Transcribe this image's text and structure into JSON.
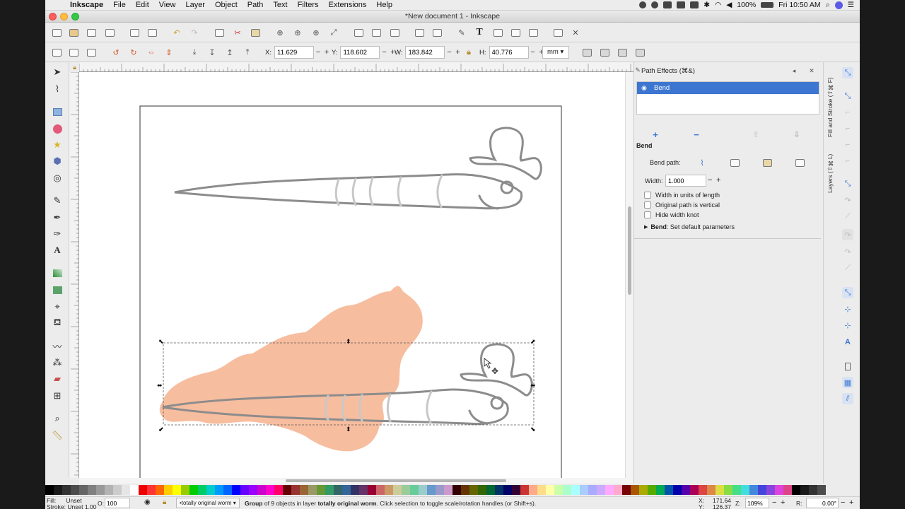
{
  "menubar": {
    "app_name": "Inkscape",
    "items": [
      "File",
      "Edit",
      "View",
      "Layer",
      "Object",
      "Path",
      "Text",
      "Filters",
      "Extensions",
      "Help"
    ],
    "battery": "100%",
    "clock": "Fri 10:50 AM"
  },
  "window": {
    "title": "*New document 1 - Inkscape"
  },
  "toolbar": {
    "x_label": "X:",
    "x_value": "11.629",
    "y_label": "Y:",
    "y_value": "118.602",
    "w_label": "W:",
    "w_value": "183.842",
    "h_label": "H:",
    "h_value": "40.776",
    "unit": "mm"
  },
  "dock": {
    "title": "Path Effects (⌘&)",
    "effects": [
      "Bend"
    ],
    "section_title": "Bend",
    "bend_path_label": "Bend path:",
    "width_label": "Width:",
    "width_value": "1.000",
    "checkboxes": [
      "Width in units of length",
      "Original path is vertical",
      "Hide width knot"
    ],
    "defaults_bold": "Bend",
    "defaults_rest": ": Set default parameters"
  },
  "side_tabs": {
    "fill_stroke": "Fill and Stroke (⇧⌘F)",
    "layers": "Layers (⇧⌘L)"
  },
  "status": {
    "fill_label": "Fill:",
    "fill_value": "Unset",
    "stroke_label": "Stroke:",
    "stroke_value": "Unset",
    "stroke_width": "1.00",
    "opacity_label": "O:",
    "opacity_value": "100",
    "layer": "•totally original worm",
    "message_pre": "Group",
    "message_mid": " of 9 objects in layer ",
    "message_layer": "totally original worm",
    "message_post": ". Click selection to toggle scale/rotation handles (or Shift+s).",
    "cursor_x_label": "X:",
    "cursor_x": "171.64",
    "cursor_y_label": "Y:",
    "cursor_y": "126.37",
    "zoom_label": "Z:",
    "zoom": "109%",
    "rotate_label": "R:",
    "rotate": "0.00°"
  },
  "colors": {
    "selection": "#3d76d1",
    "blob": "#f7bd9f",
    "stroke": "#8c8c8c"
  }
}
